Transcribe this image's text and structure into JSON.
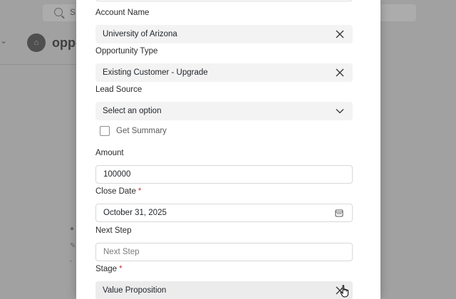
{
  "background": {
    "search_letter": "S",
    "avatar_glyph": "⌂",
    "title_partial": "oppo"
  },
  "form": {
    "account_name": {
      "label": "Account Name",
      "value": "University of Arizona"
    },
    "opportunity_type": {
      "label": "Opportunity Type",
      "value": "Existing Customer - Upgrade"
    },
    "lead_source": {
      "label": "Lead Source",
      "placeholder": "Select an option"
    },
    "get_summary": {
      "label": "Get Summary",
      "checked": false
    },
    "amount": {
      "label": "Amount",
      "value": "100000"
    },
    "close_date": {
      "label": "Close Date",
      "required_mark": "*",
      "value": "October 31, 2025"
    },
    "next_step": {
      "label": "Next Step",
      "placeholder": "Next Step",
      "value": ""
    },
    "stage": {
      "label": "Stage",
      "required_mark": "*",
      "value": "Value Proposition"
    }
  },
  "icons": {
    "clear": "close-icon",
    "dropdown": "chevron-down-icon",
    "calendar": "calendar-icon",
    "cursor": "hand-pointer-icon"
  },
  "colors": {
    "required": "#c23934",
    "filled_input": "#f3f3f3",
    "overlay": "#7a7a7a"
  }
}
